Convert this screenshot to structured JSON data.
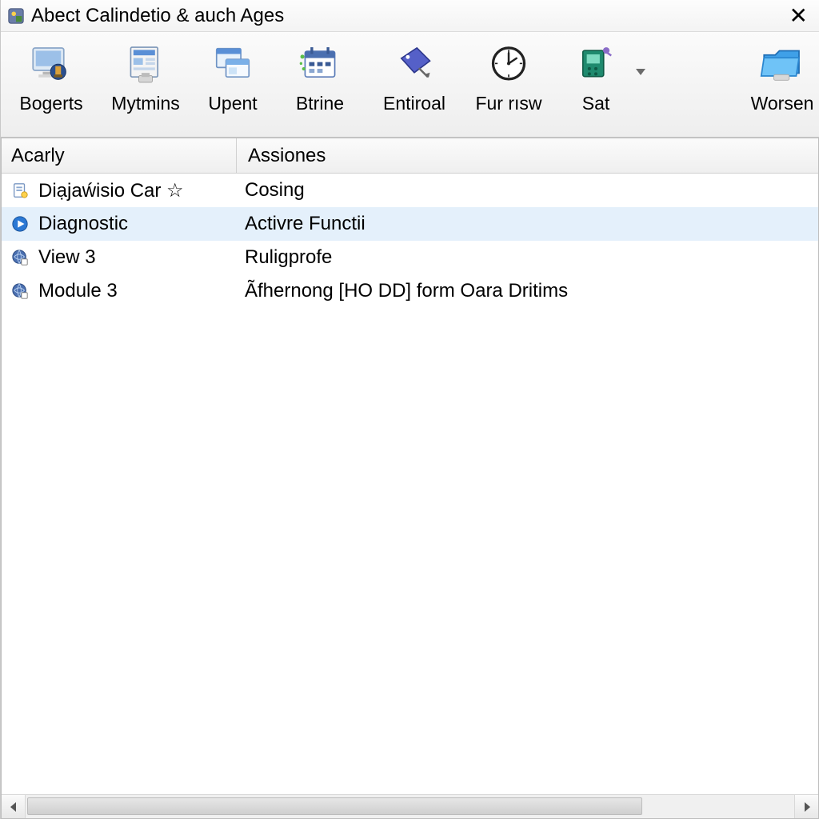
{
  "window": {
    "title": "Abect Calindetio & auch Ages"
  },
  "toolbar": {
    "items": [
      {
        "label": "Bogerts"
      },
      {
        "label": "Mytmins"
      },
      {
        "label": "Upent"
      },
      {
        "label": "Btrine"
      },
      {
        "label": "Entiroal"
      },
      {
        "label": "Fur rısw"
      },
      {
        "label": "Sat"
      },
      {
        "label": "Worsen"
      }
    ]
  },
  "columns": {
    "col1": "Acarly",
    "col2": "Assiones"
  },
  "rows": [
    {
      "acarly": "Diạjaẃisio Car ☆",
      "assiones": "Cosing",
      "selected": false,
      "icon": "doc"
    },
    {
      "acarly": "Diagnostic",
      "assiones": "Activre Functii",
      "selected": true,
      "icon": "play"
    },
    {
      "acarly": "View 3",
      "assiones": "Ruligprofe",
      "selected": false,
      "icon": "globe"
    },
    {
      "acarly": "Module 3",
      "assiones": "Ãfhernong [HO DD] form Oara Dritims",
      "selected": false,
      "icon": "globe2"
    }
  ]
}
